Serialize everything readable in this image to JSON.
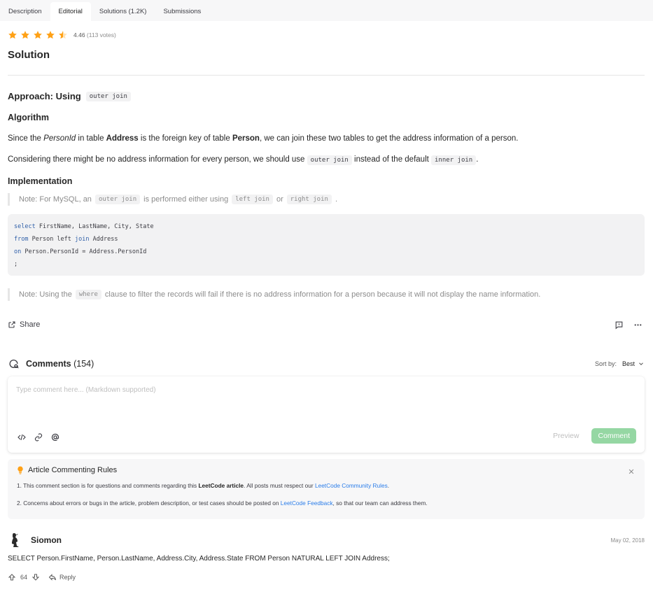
{
  "tabs": [
    {
      "label": "Description"
    },
    {
      "label": "Editorial"
    },
    {
      "label": "Solutions (1.2K)"
    },
    {
      "label": "Submissions"
    }
  ],
  "rating": {
    "value": "4.46",
    "votes": "(113 votes)",
    "star_color": "#ffa116"
  },
  "solution_title": "Solution",
  "approach": {
    "label": "Approach: Using",
    "code": "outer join"
  },
  "algorithm": {
    "heading": "Algorithm",
    "p1": {
      "t1": "Since the ",
      "i1": "PersonId",
      "t2": " in table ",
      "b1": "Address",
      "t3": " is the foreign key of table ",
      "b2": "Person",
      "t4": ", we can join these two tables to get the address information of a person."
    },
    "p2": {
      "t1": "Considering there might be no address information for every person, we should use ",
      "c1": "outer join",
      "t2": " instead of the default ",
      "c2": "inner join",
      "t3": "."
    }
  },
  "implementation": {
    "heading": "Implementation",
    "note1": {
      "t1": "Note: For MySQL, an ",
      "c1": "outer join",
      "t2": " is performed either using ",
      "c2": "left join",
      "t3": " or ",
      "c3": "right join",
      "t4": "."
    },
    "code": {
      "l1_kw": "select",
      "l1": " FirstName, LastName, City, State",
      "l2_kw": "from",
      "l2a": " Person left ",
      "l2_kw2": "join",
      "l2b": " Address",
      "l3_kw": "on",
      "l3": " Person.PersonId = Address.PersonId",
      "l4": ";"
    },
    "note2": {
      "t1": "Note: Using the ",
      "c1": "where",
      "t2": " clause to filter the records will fail if there is no address information for a person because it will not display the name information."
    }
  },
  "share_label": "Share",
  "comments": {
    "title": "Comments",
    "count": "(154)",
    "sort_label": "Sort by:",
    "sort_value": "Best",
    "placeholder": "Type comment here... (Markdown supported)",
    "preview_label": "Preview",
    "comment_label": "Comment",
    "accent": "#95d7a3"
  },
  "rules": {
    "title": "Article Commenting Rules",
    "line1": {
      "t1": "1. This comment section is for questions and comments regarding this ",
      "b1": "LeetCode article",
      "t2": ". All posts must respect our ",
      "a1": "LeetCode Community Rules",
      "t3": "."
    },
    "line2": {
      "t1": "2. Concerns about errors or bugs in the article, problem description, or test cases should be posted on ",
      "a1": "LeetCode Feedback",
      "t2": ", so that our team can address them."
    },
    "link_color": "#2b7de9"
  },
  "comment_items": [
    {
      "user": "Siomon",
      "date": "May 02, 2018",
      "text": "SELECT Person.FirstName, Person.LastName, Address.City, Address.State FROM Person NATURAL LEFT JOIN Address;",
      "votes": "64",
      "reply_label": "Reply"
    }
  ]
}
